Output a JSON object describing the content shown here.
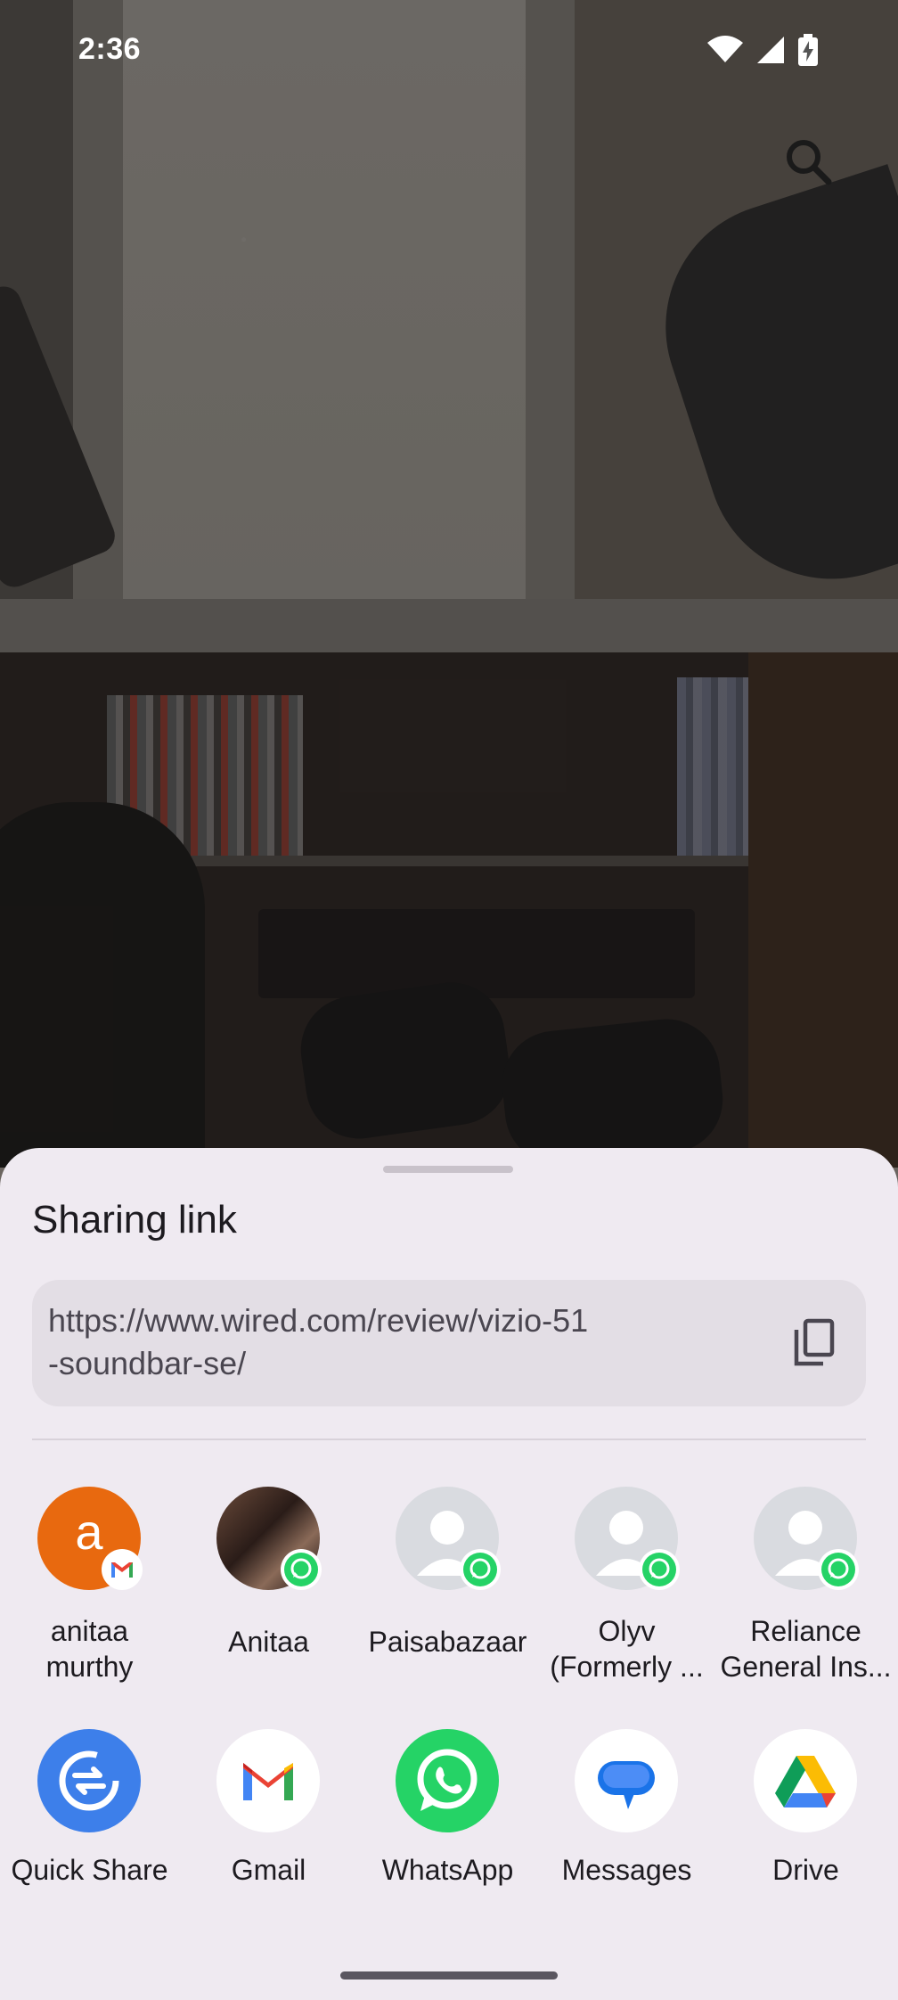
{
  "status_bar": {
    "time": "2:36"
  },
  "share_sheet": {
    "title": "Sharing link",
    "link_line1": "https://www.wired.com/review/vizio-51",
    "link_line2": "-soundbar-se/"
  },
  "contacts": [
    {
      "line1": "anitaa",
      "line2": "murthy",
      "initial": "a",
      "badge": "gmail"
    },
    {
      "line1": "Anitaa",
      "line2": "",
      "badge": "whatsapp"
    },
    {
      "line1": "Paisabazaar",
      "line2": "",
      "badge": "whatsapp"
    },
    {
      "line1": "Olyv",
      "line2": "(Formerly ...",
      "badge": "whatsapp"
    },
    {
      "line1": "Reliance",
      "line2": "General Ins...",
      "badge": "whatsapp"
    }
  ],
  "apps": [
    {
      "label": "Quick Share",
      "icon": "quick-share-icon",
      "color": "#3d7fea"
    },
    {
      "label": "Gmail",
      "icon": "gmail-icon",
      "color": "#ffffff"
    },
    {
      "label": "WhatsApp",
      "icon": "whatsapp-icon",
      "color": "#25d366"
    },
    {
      "label": "Messages",
      "icon": "messages-icon",
      "color": "#ffffff"
    },
    {
      "label": "Drive",
      "icon": "drive-icon",
      "color": "#ffffff"
    }
  ],
  "colors": {
    "sheet_bg": "#efeaf1",
    "link_box_bg": "#e3dee5",
    "avatar_orange": "#e8690f",
    "whatsapp_green": "#25d366",
    "quick_share_blue": "#3d7fea"
  }
}
